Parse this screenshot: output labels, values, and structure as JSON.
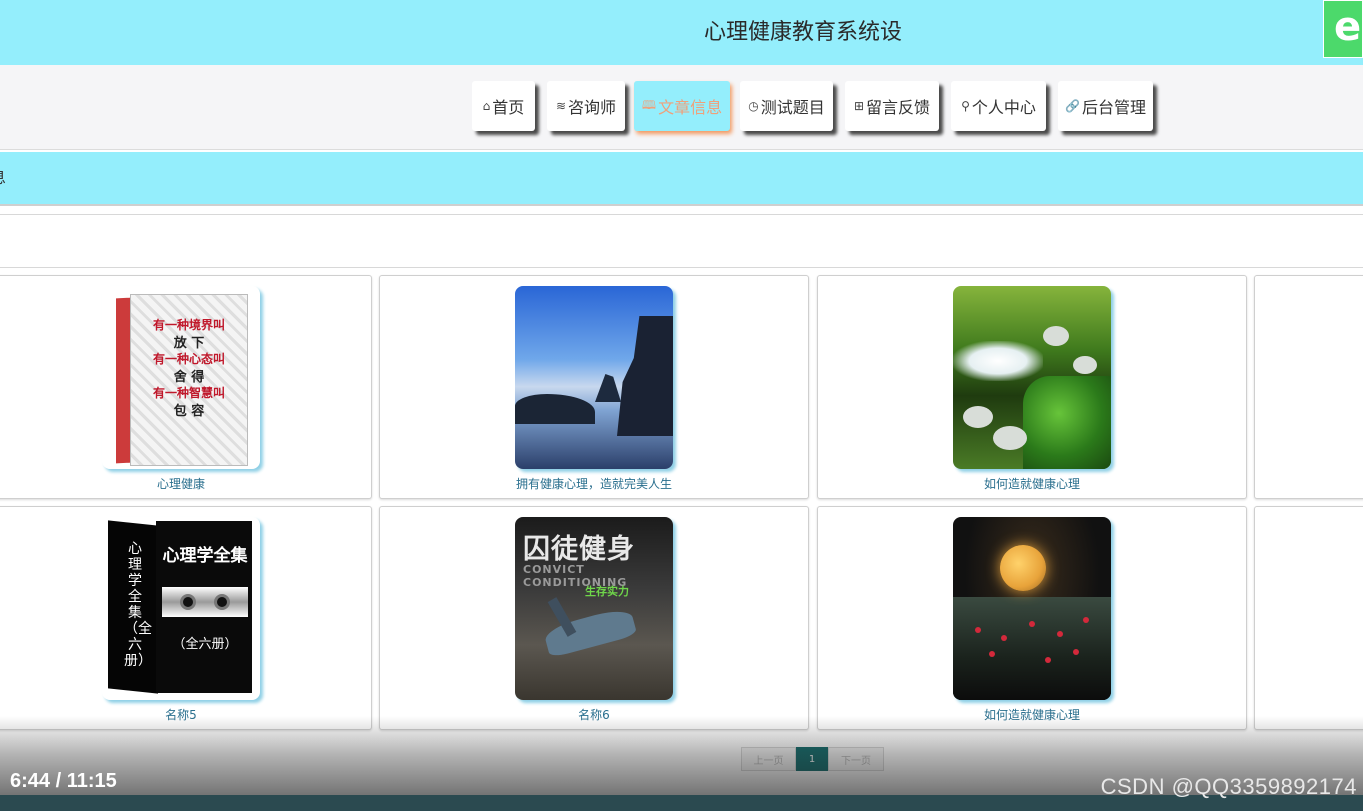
{
  "header": {
    "site_title": "心理健康教育系统设",
    "logo_letter": "e"
  },
  "nav": {
    "items": [
      {
        "label": "首页",
        "icon": "home-icon",
        "glyph": "⌂",
        "active": false
      },
      {
        "label": "咨询师",
        "icon": "layers-icon",
        "glyph": "≋",
        "active": false
      },
      {
        "label": "文章信息",
        "icon": "book-icon",
        "glyph": "🕮",
        "active": true
      },
      {
        "label": "测试题目",
        "icon": "clock-icon",
        "glyph": "◷",
        "active": false
      },
      {
        "label": "留言反馈",
        "icon": "grid-icon",
        "glyph": "⊞",
        "active": false
      },
      {
        "label": "个人中心",
        "icon": "user-icon",
        "glyph": "⚲",
        "active": false
      },
      {
        "label": "后台管理",
        "icon": "link-icon",
        "glyph": "🔗",
        "active": false
      }
    ],
    "active_color": "#f0a07a",
    "bar_color": "#94eefc"
  },
  "breadcrumb": {
    "text": "息"
  },
  "articles": [
    {
      "title": "心理健康"
    },
    {
      "title": "拥有健康心理，造就完美人生"
    },
    {
      "title": "如何造就健康心理"
    },
    {
      "title": "名称5"
    },
    {
      "title": "名称6"
    },
    {
      "title": "如何造就健康心理"
    }
  ],
  "book1": {
    "lines": [
      "有一种境界叫",
      "放 下",
      "有一种心态叫",
      "舍 得",
      "有一种智慧叫",
      "包 容"
    ]
  },
  "book2": {
    "title": "心理学全集",
    "volume": "（全六册）",
    "spine": "心理学全集（全六册）"
  },
  "fitness": {
    "title": "囚徒健身",
    "subtitle": "CONVICT CONDITIONING",
    "tagline": "生存实力"
  },
  "pagination": {
    "prev": "上一页",
    "current": "1",
    "next": "下一页"
  },
  "video": {
    "time": "6:44 / 11:15"
  },
  "watermark": "CSDN @QQ3359892174"
}
